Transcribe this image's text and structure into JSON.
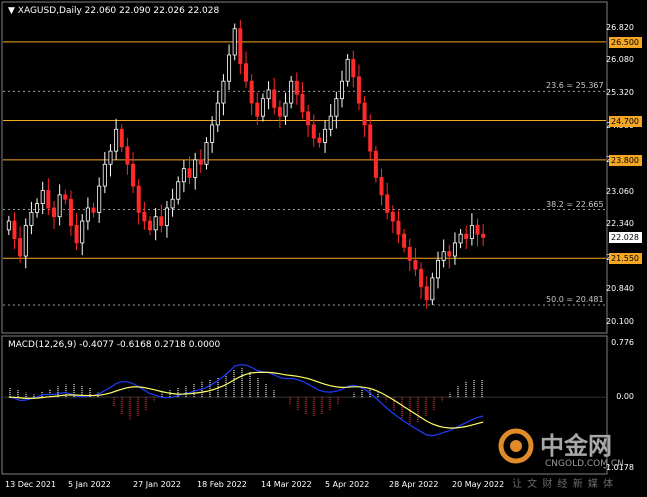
{
  "header": {
    "symbol_line": "XAGUSD,Daily  22.060 22.090 22.026 22.028",
    "macd_line": "MACD(12,26,9) -0.4077 -0.6168 0.2718 0.0000"
  },
  "price_axis": [
    "26.820",
    "26.080",
    "25.320",
    "24.580",
    "23.800",
    "23.060",
    "22.340",
    "21.550",
    "20.840",
    "20.100"
  ],
  "macd_axis": [
    "0.776",
    "0.00",
    "-1.0178"
  ],
  "time_axis": [
    "13 Dec 2021",
    "5 Jan 2022",
    "27 Jan 2022",
    "18 Feb 2022",
    "14 Mar 2022",
    "5 Apr 2022",
    "28 Apr 2022",
    "20 May 2022"
  ],
  "levels": [
    {
      "label": "26.500",
      "price": 26.5
    },
    {
      "label": "24.700",
      "price": 24.7
    },
    {
      "label": "23.800",
      "price": 23.8
    },
    {
      "label": "21.550",
      "price": 21.55
    }
  ],
  "current_price": {
    "label": "22.028",
    "price": 22.028
  },
  "fib_levels": [
    {
      "label": "23.6 = 25.367",
      "price": 25.367
    },
    {
      "label": "38.2 = 22.665",
      "price": 22.665
    },
    {
      "label": "50.0 = 20.481",
      "price": 20.481
    }
  ],
  "colors": {
    "background": "#000000",
    "bull_candle": "#ffffff",
    "bear_candle": "#ff2a2a",
    "level_line": "#f5a623",
    "macd_line": "#1e3cff",
    "signal_line": "#ffff66",
    "hist_pos": "#ffffff",
    "hist_neg": "#ff3b3b"
  },
  "watermark": {
    "brand": "中金网",
    "tagline": "让 文 财 经 新 媒 体",
    "url": "CNGOLD.COM.CN"
  },
  "chart_data": {
    "type": "candlestick",
    "symbol": "XAGUSD",
    "timeframe": "Daily",
    "ylim": [
      20.0,
      27.0
    ],
    "ohlc_close_series": [
      22.4,
      22.0,
      21.6,
      22.3,
      22.6,
      22.8,
      23.1,
      22.7,
      22.5,
      23.0,
      22.9,
      22.3,
      21.9,
      22.4,
      22.7,
      22.6,
      23.2,
      23.7,
      24.0,
      24.5,
      24.1,
      23.7,
      23.2,
      22.6,
      22.4,
      22.2,
      22.5,
      22.3,
      22.7,
      22.9,
      23.3,
      23.6,
      23.4,
      23.8,
      23.7,
      24.2,
      24.6,
      25.1,
      25.6,
      26.2,
      26.8,
      26.0,
      25.6,
      25.1,
      24.8,
      25.2,
      25.4,
      25.0,
      24.8,
      25.1,
      25.6,
      25.3,
      24.9,
      24.6,
      24.3,
      24.2,
      24.5,
      24.8,
      25.2,
      25.6,
      26.1,
      25.7,
      25.1,
      24.6,
      24.0,
      23.4,
      23.0,
      22.6,
      22.4,
      22.1,
      21.8,
      21.5,
      21.3,
      20.9,
      20.6,
      21.1,
      21.5,
      21.7,
      21.6,
      21.9,
      22.1,
      22.0,
      22.3,
      22.1,
      22.028
    ],
    "macd_ylim": [
      -1.0178,
      0.776
    ],
    "macd_histogram": [
      0.1,
      0.08,
      0.05,
      0.03,
      0.06,
      0.09,
      0.12,
      0.14,
      0.15,
      0.13,
      0.1,
      0.05,
      0.0,
      -0.1,
      -0.2,
      -0.25,
      -0.22,
      -0.15,
      -0.05,
      0.05,
      0.08,
      0.1,
      0.12,
      0.15,
      0.18,
      0.2,
      0.22,
      0.25,
      0.3,
      0.32,
      0.28,
      0.22,
      0.15,
      0.08,
      0.0,
      -0.08,
      -0.15,
      -0.2,
      -0.22,
      -0.2,
      -0.15,
      -0.08,
      0.0,
      0.05,
      0.08,
      0.1,
      0.05,
      -0.05,
      -0.15,
      -0.25,
      -0.3,
      -0.28,
      -0.22,
      -0.15,
      -0.05,
      0.05,
      0.12,
      0.18,
      0.2,
      0.2
    ]
  }
}
